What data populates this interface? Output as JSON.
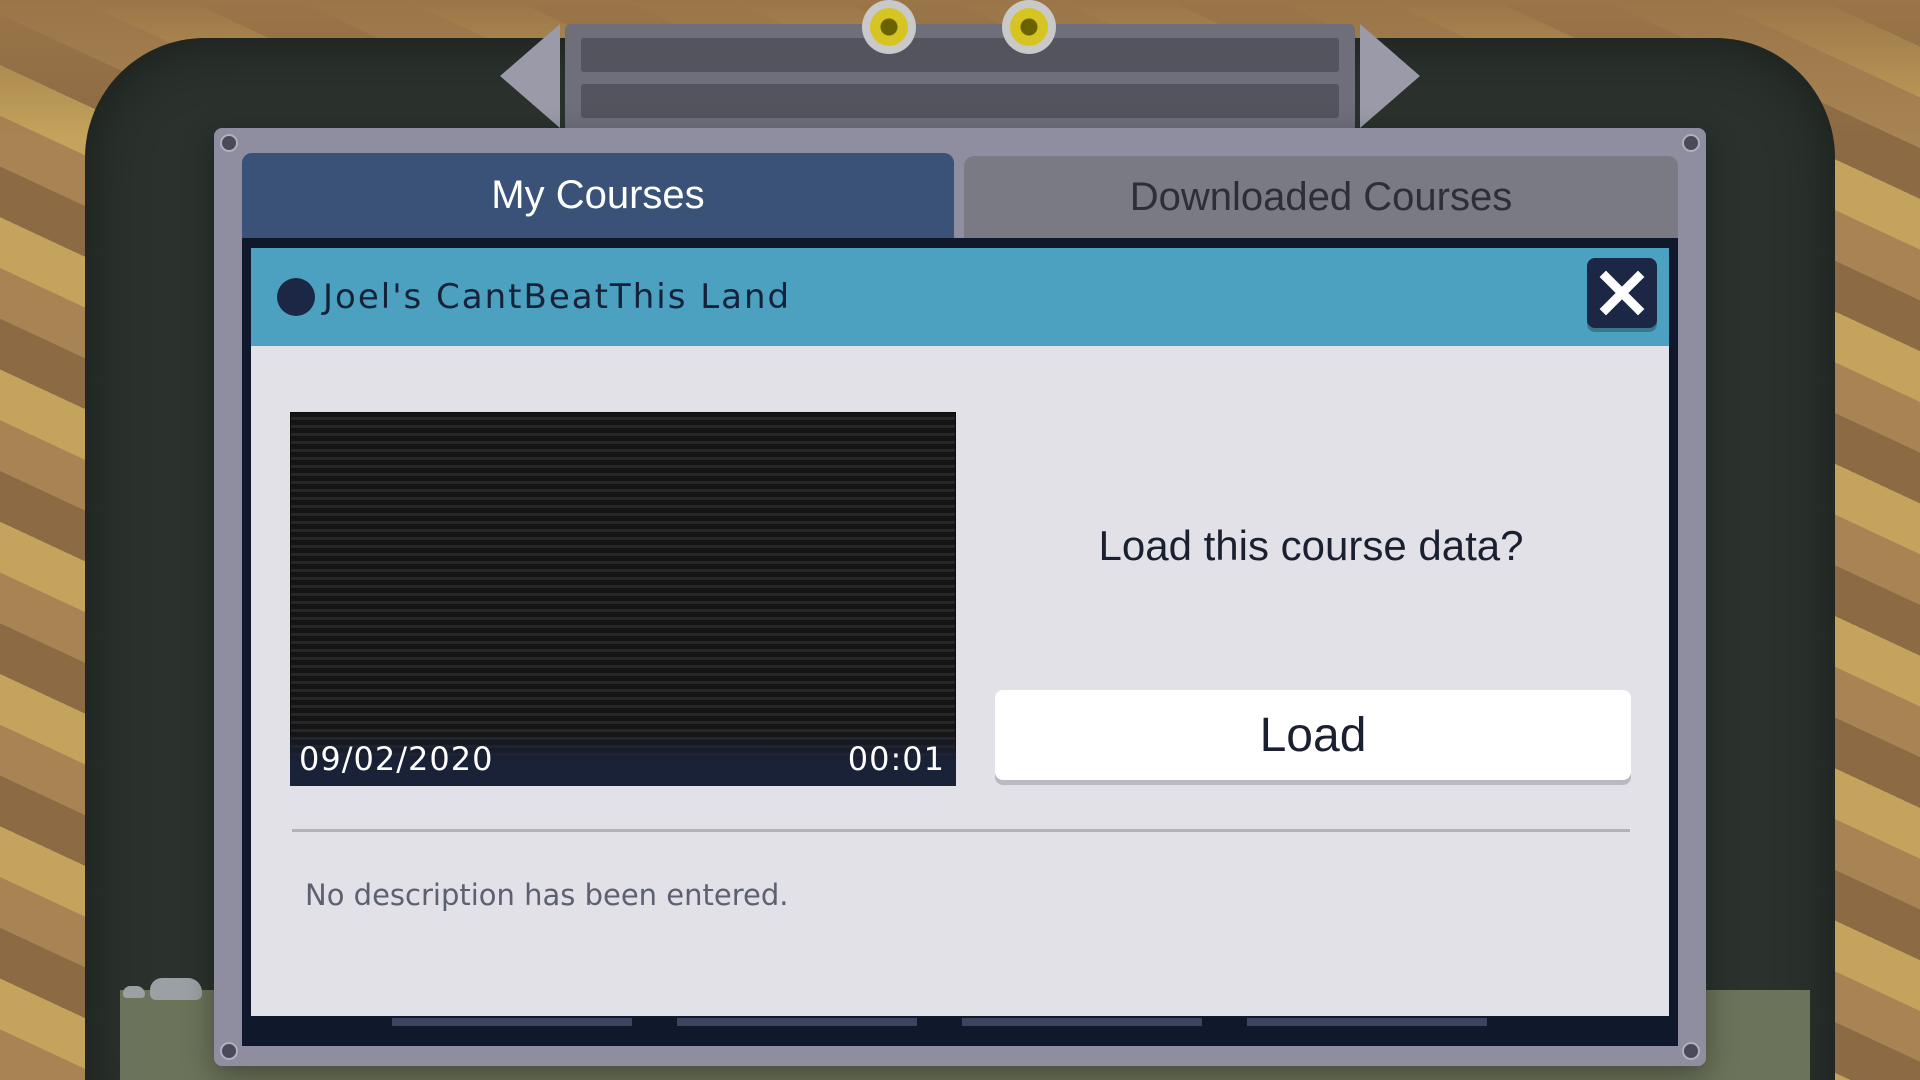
{
  "tabs": {
    "my_courses": "My Courses",
    "downloaded_courses": "Downloaded Courses"
  },
  "course": {
    "title": "Joel's CantBeatThis Land",
    "date": "09/02/2020",
    "time": "00:01",
    "description": "No description has been entered."
  },
  "dialog": {
    "prompt": "Load this course data?",
    "load_label": "Load"
  },
  "colors": {
    "active_tab": "#3a5178",
    "inactive_tab": "#7a7a84",
    "header": "#4ba1bf",
    "panel": "#e1e1e7",
    "close_button": "#1b2744"
  },
  "icons": {
    "close": "close-icon",
    "indicator": "course-status-dot-icon"
  }
}
